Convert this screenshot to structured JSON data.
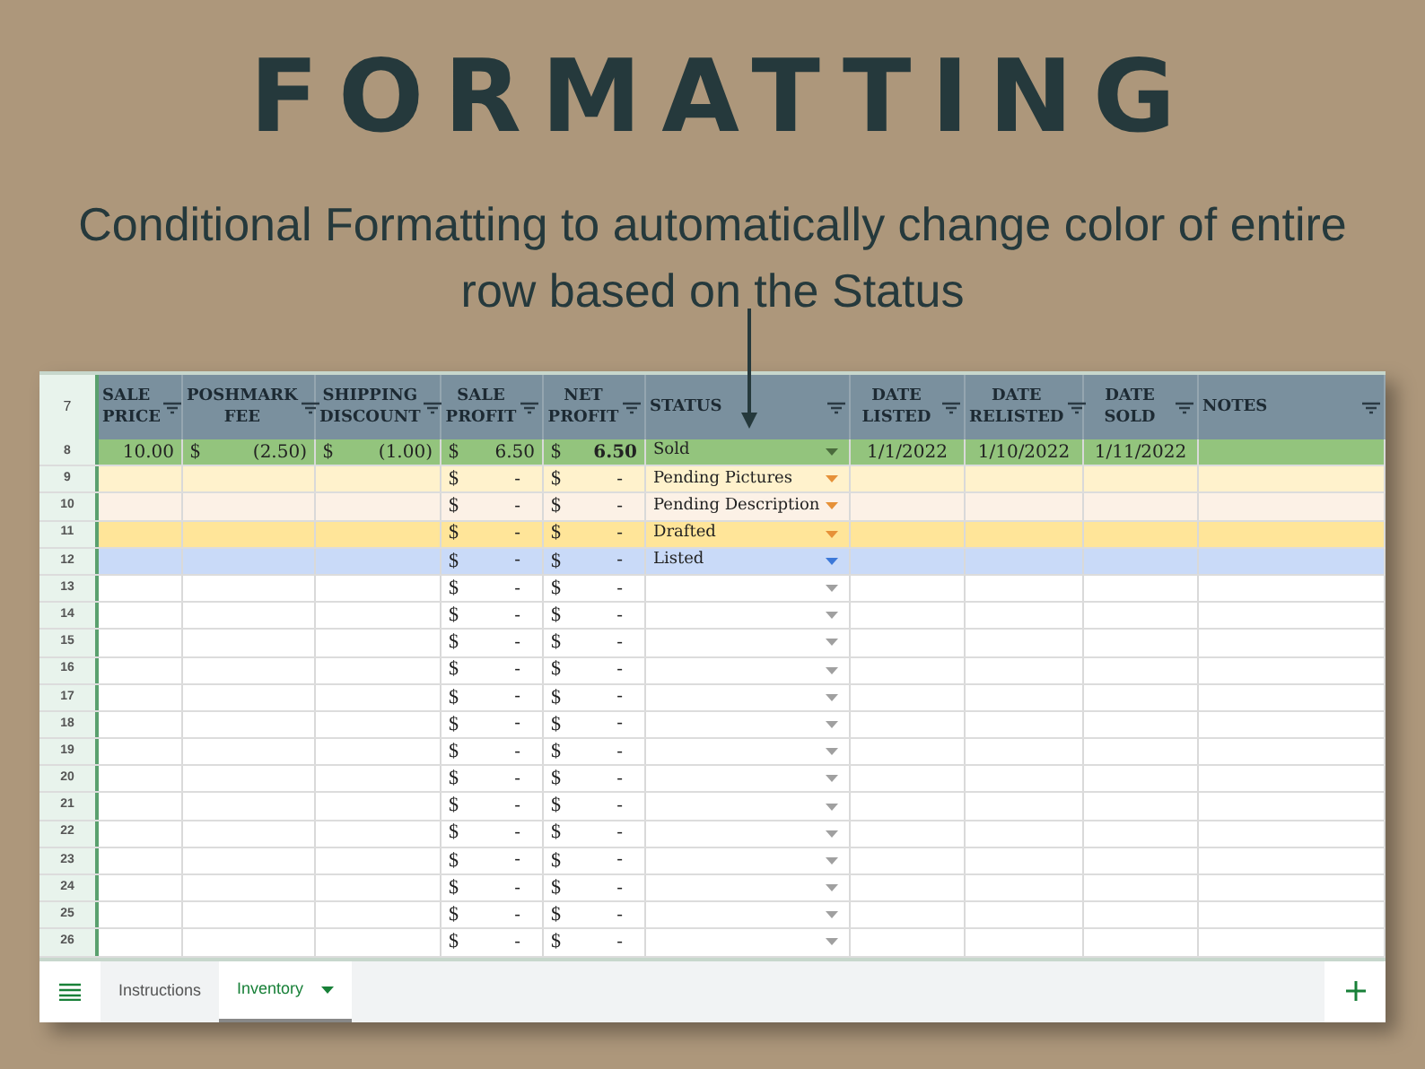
{
  "title": "FORMATTING",
  "subtitle": "Conditional Formatting to automatically change color of entire row based on the Status",
  "sheet": {
    "header_row_number": "7",
    "columns": [
      {
        "label": "SALE PRICE"
      },
      {
        "label": "POSHMARK FEE"
      },
      {
        "label": "SHIPPING DISCOUNT"
      },
      {
        "label": "SALE PROFIT"
      },
      {
        "label": "NET PROFIT"
      },
      {
        "label": "STATUS"
      },
      {
        "label": "DATE LISTED"
      },
      {
        "label": "DATE RELISTED"
      },
      {
        "label": "DATE SOLD"
      },
      {
        "label": "NOTES"
      }
    ],
    "rows": [
      {
        "number": "8",
        "color": "#93c47d",
        "dropdown": {
          "color": "#4a6b3c"
        },
        "sale_price": "10.00",
        "poshmark_fee": {
          "symbol": "$",
          "amount": "(2.50)"
        },
        "shipping_discount": {
          "symbol": "$",
          "amount": "(1.00)"
        },
        "sale_profit": {
          "symbol": "$",
          "amount": "6.50"
        },
        "net_profit": {
          "symbol": "$",
          "amount": "6.50"
        },
        "status": "Sold",
        "date_listed": "1/1/2022",
        "date_relisted": "1/10/2022",
        "date_sold": "1/11/2022"
      },
      {
        "number": "9",
        "color": "#fff2cc",
        "dropdown": {
          "color": "#e69138"
        },
        "sale_profit": {
          "symbol": "$",
          "amount": "-"
        },
        "net_profit": {
          "symbol": "$",
          "amount": "-"
        },
        "status": "Pending Pictures"
      },
      {
        "number": "10",
        "color": "#fcf1e6",
        "dropdown": {
          "color": "#e69138"
        },
        "sale_profit": {
          "symbol": "$",
          "amount": "-"
        },
        "net_profit": {
          "symbol": "$",
          "amount": "-"
        },
        "status": "Pending Description"
      },
      {
        "number": "11",
        "color": "#ffe599",
        "dropdown": {
          "color": "#e69138"
        },
        "sale_profit": {
          "symbol": "$",
          "amount": "-"
        },
        "net_profit": {
          "symbol": "$",
          "amount": "-"
        },
        "status": "Drafted"
      },
      {
        "number": "12",
        "color": "#c9daf8",
        "dropdown": {
          "color": "#3c78d8"
        },
        "sale_profit": {
          "symbol": "$",
          "amount": "-"
        },
        "net_profit": {
          "symbol": "$",
          "amount": "-"
        },
        "status": "Listed"
      },
      {
        "number": "13",
        "color": "#ffffff",
        "dropdown": {
          "color": "#a0a0a0"
        },
        "sale_profit": {
          "symbol": "$",
          "amount": "-"
        },
        "net_profit": {
          "symbol": "$",
          "amount": "-"
        }
      },
      {
        "number": "14",
        "color": "#ffffff",
        "dropdown": {
          "color": "#a0a0a0"
        },
        "sale_profit": {
          "symbol": "$",
          "amount": "-"
        },
        "net_profit": {
          "symbol": "$",
          "amount": "-"
        }
      },
      {
        "number": "15",
        "color": "#ffffff",
        "dropdown": {
          "color": "#a0a0a0"
        },
        "sale_profit": {
          "symbol": "$",
          "amount": "-"
        },
        "net_profit": {
          "symbol": "$",
          "amount": "-"
        }
      },
      {
        "number": "16",
        "color": "#ffffff",
        "dropdown": {
          "color": "#a0a0a0"
        },
        "sale_profit": {
          "symbol": "$",
          "amount": "-"
        },
        "net_profit": {
          "symbol": "$",
          "amount": "-"
        }
      },
      {
        "number": "17",
        "color": "#ffffff",
        "dropdown": {
          "color": "#a0a0a0"
        },
        "sale_profit": {
          "symbol": "$",
          "amount": "-"
        },
        "net_profit": {
          "symbol": "$",
          "amount": "-"
        }
      },
      {
        "number": "18",
        "color": "#ffffff",
        "dropdown": {
          "color": "#a0a0a0"
        },
        "sale_profit": {
          "symbol": "$",
          "amount": "-"
        },
        "net_profit": {
          "symbol": "$",
          "amount": "-"
        }
      },
      {
        "number": "19",
        "color": "#ffffff",
        "dropdown": {
          "color": "#a0a0a0"
        },
        "sale_profit": {
          "symbol": "$",
          "amount": "-"
        },
        "net_profit": {
          "symbol": "$",
          "amount": "-"
        }
      },
      {
        "number": "20",
        "color": "#ffffff",
        "dropdown": {
          "color": "#a0a0a0"
        },
        "sale_profit": {
          "symbol": "$",
          "amount": "-"
        },
        "net_profit": {
          "symbol": "$",
          "amount": "-"
        }
      },
      {
        "number": "21",
        "color": "#ffffff",
        "dropdown": {
          "color": "#a0a0a0"
        },
        "sale_profit": {
          "symbol": "$",
          "amount": "-"
        },
        "net_profit": {
          "symbol": "$",
          "amount": "-"
        }
      },
      {
        "number": "22",
        "color": "#ffffff",
        "dropdown": {
          "color": "#a0a0a0"
        },
        "sale_profit": {
          "symbol": "$",
          "amount": "-"
        },
        "net_profit": {
          "symbol": "$",
          "amount": "-"
        }
      },
      {
        "number": "23",
        "color": "#ffffff",
        "dropdown": {
          "color": "#a0a0a0"
        },
        "sale_profit": {
          "symbol": "$",
          "amount": "-"
        },
        "net_profit": {
          "symbol": "$",
          "amount": "-"
        }
      },
      {
        "number": "24",
        "color": "#ffffff",
        "dropdown": {
          "color": "#a0a0a0"
        },
        "sale_profit": {
          "symbol": "$",
          "amount": "-"
        },
        "net_profit": {
          "symbol": "$",
          "amount": "-"
        }
      },
      {
        "number": "25",
        "color": "#ffffff",
        "dropdown": {
          "color": "#a0a0a0"
        },
        "sale_profit": {
          "symbol": "$",
          "amount": "-"
        },
        "net_profit": {
          "symbol": "$",
          "amount": "-"
        }
      },
      {
        "number": "26",
        "color": "#ffffff",
        "dropdown": {
          "color": "#a0a0a0"
        },
        "sale_profit": {
          "symbol": "$",
          "amount": "-"
        },
        "net_profit": {
          "symbol": "$",
          "amount": "-"
        }
      }
    ],
    "tabs": [
      {
        "label": "Instructions",
        "selected": false
      },
      {
        "label": "Inventory",
        "selected": true
      }
    ]
  }
}
